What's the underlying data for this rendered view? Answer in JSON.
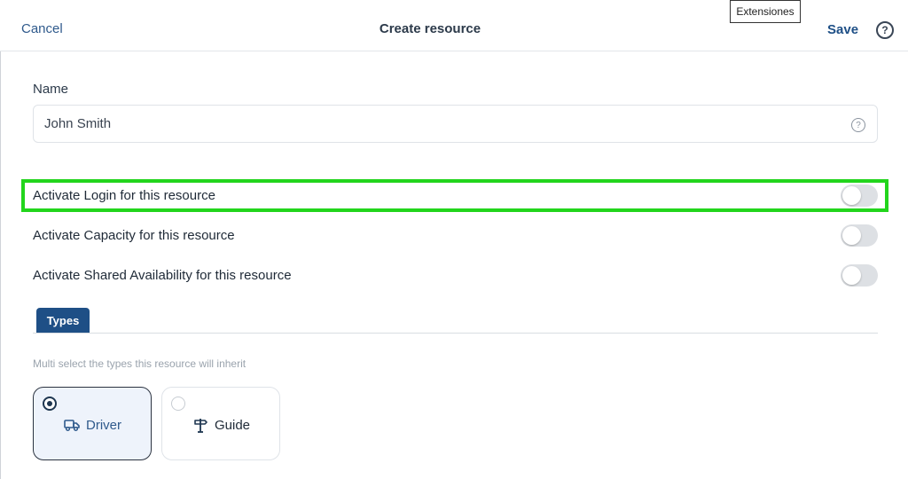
{
  "header": {
    "cancel_label": "Cancel",
    "title": "Create resource",
    "save_label": "Save",
    "help_glyph": "?",
    "tooltip": "Extensiones"
  },
  "form": {
    "name_label": "Name",
    "name_value": "John Smith",
    "name_help_glyph": "?",
    "toggles": [
      {
        "label": "Activate Login for this resource",
        "on": false
      },
      {
        "label": "Activate Capacity for this resource",
        "on": false
      },
      {
        "label": "Activate Shared Availability for this resource",
        "on": false
      }
    ]
  },
  "types": {
    "tab_label": "Types",
    "hint": "Multi select the types this resource will inherit",
    "options": [
      {
        "label": "Driver",
        "icon": "truck-icon",
        "selected": true
      },
      {
        "label": "Guide",
        "icon": "signpost-icon",
        "selected": false
      }
    ]
  },
  "colors": {
    "accent": "#1e4f86",
    "highlight": "#22d51c",
    "toggle_off": "#dde0e4"
  }
}
